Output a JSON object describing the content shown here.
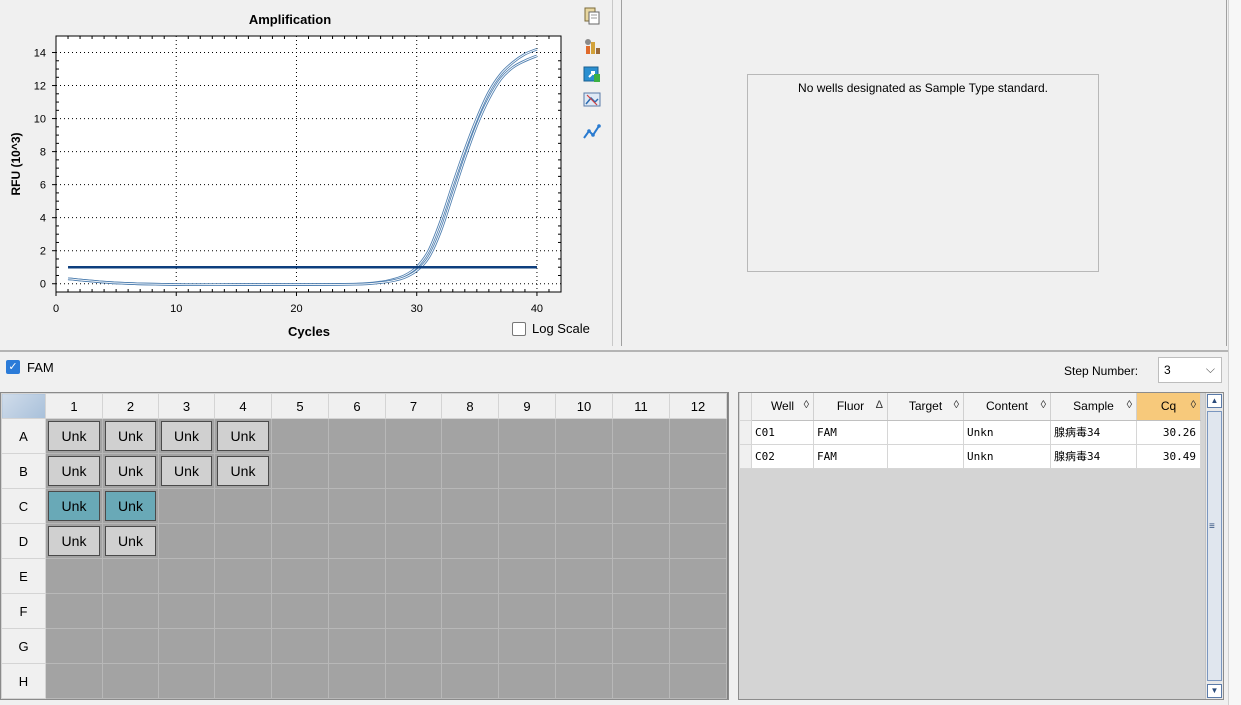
{
  "chart": {
    "title": "Amplification",
    "xlabel": "Cycles",
    "ylabel": "RFU (10^3)",
    "x_ticks": [
      "0",
      "10",
      "20",
      "30",
      "40"
    ],
    "y_ticks": [
      "0",
      "2",
      "4",
      "6",
      "8",
      "10",
      "12",
      "14"
    ],
    "log_scale_label": "Log Scale"
  },
  "chart_data": {
    "type": "line",
    "title": "Amplification",
    "xlabel": "Cycles",
    "ylabel": "RFU (10^3)",
    "xlim": [
      0,
      42
    ],
    "ylim": [
      -0.5,
      15
    ],
    "grid": true,
    "threshold": 1.0,
    "series": [
      {
        "x": [
          1,
          5,
          10,
          15,
          20,
          25,
          27,
          28,
          29,
          30,
          31,
          32,
          33,
          34,
          35,
          36,
          37,
          38,
          39,
          40
        ],
        "y": [
          0.3,
          0.05,
          -0.05,
          -0.05,
          -0.05,
          -0.02,
          0.1,
          0.25,
          0.5,
          1.0,
          2.0,
          3.8,
          6.0,
          8.1,
          10.0,
          11.6,
          12.7,
          13.4,
          13.9,
          14.2
        ]
      },
      {
        "x": [
          1,
          5,
          10,
          15,
          20,
          25,
          27,
          28,
          29,
          30,
          31,
          32,
          33,
          34,
          35,
          36,
          37,
          38,
          39,
          40
        ],
        "y": [
          0.3,
          0.05,
          -0.05,
          -0.05,
          -0.05,
          -0.03,
          0.07,
          0.18,
          0.38,
          0.8,
          1.6,
          3.2,
          5.4,
          7.6,
          9.6,
          11.2,
          12.4,
          13.1,
          13.5,
          13.8
        ]
      }
    ],
    "colors": {
      "curve": "#4f7fb0",
      "threshold": "#0e3f7e"
    }
  },
  "standard_pane": {
    "message": "No wells designated as Sample Type standard."
  },
  "fluor_bar": {
    "fam_label": "FAM",
    "step_label": "Step Number:",
    "step_value": "3"
  },
  "plate": {
    "columns": [
      "1",
      "2",
      "3",
      "4",
      "5",
      "6",
      "7",
      "8",
      "9",
      "10",
      "11",
      "12"
    ],
    "rows": [
      "A",
      "B",
      "C",
      "D",
      "E",
      "F",
      "G",
      "H"
    ],
    "wells": {
      "A": [
        "Unk",
        "Unk",
        "Unk",
        "Unk",
        "",
        "",
        "",
        "",
        "",
        "",
        "",
        ""
      ],
      "B": [
        "Unk",
        "Unk",
        "Unk",
        "Unk",
        "",
        "",
        "",
        "",
        "",
        "",
        "",
        ""
      ],
      "C": [
        "Unk",
        "Unk",
        "",
        "",
        "",
        "",
        "",
        "",
        "",
        "",
        "",
        ""
      ],
      "D": [
        "Unk",
        "Unk",
        "",
        "",
        "",
        "",
        "",
        "",
        "",
        "",
        "",
        ""
      ],
      "E": [
        "",
        "",
        "",
        "",
        "",
        "",
        "",
        "",
        "",
        "",
        "",
        ""
      ],
      "F": [
        "",
        "",
        "",
        "",
        "",
        "",
        "",
        "",
        "",
        "",
        "",
        ""
      ],
      "G": [
        "",
        "",
        "",
        "",
        "",
        "",
        "",
        "",
        "",
        "",
        "",
        ""
      ],
      "H": [
        "",
        "",
        "",
        "",
        "",
        "",
        "",
        "",
        "",
        "",
        "",
        ""
      ]
    },
    "selected": [
      "C1",
      "C2"
    ],
    "colors": {
      "selected": "#69a9b7",
      "filled": "#d0d0d0",
      "empty": "#a3a3a3"
    }
  },
  "results_table": {
    "headers": [
      "Well",
      "Fluor",
      "Target",
      "Content",
      "Sample",
      "Cq"
    ],
    "sort_icons": [
      "◊",
      "Δ",
      "◊",
      "◊",
      "◊",
      "◊"
    ],
    "rows": [
      [
        "C01",
        "FAM",
        "",
        "Unkn",
        "腺病毒34",
        "30.26"
      ],
      [
        "C02",
        "FAM",
        "",
        "Unkn",
        "腺病毒34",
        "30.49"
      ]
    ]
  }
}
